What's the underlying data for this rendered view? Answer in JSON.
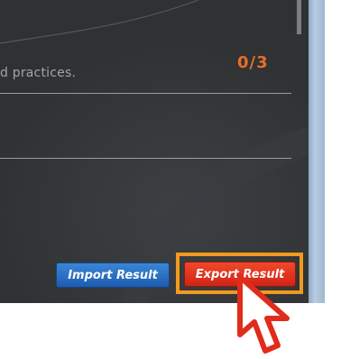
{
  "panel": {
    "description_text": "d practices.",
    "score": "0/3"
  },
  "buttons": {
    "import_label": "Import Result",
    "export_label": "Export Result"
  },
  "colors": {
    "panel_bg": "#333537",
    "score_color": "#e86d2c",
    "import_button": "#2b72c8",
    "export_button": "#e23a22",
    "highlight_frame": "#f29a1e",
    "cursor_outline": "#e12b1c"
  },
  "icons": {
    "cursor": "mouse-pointer-icon"
  }
}
